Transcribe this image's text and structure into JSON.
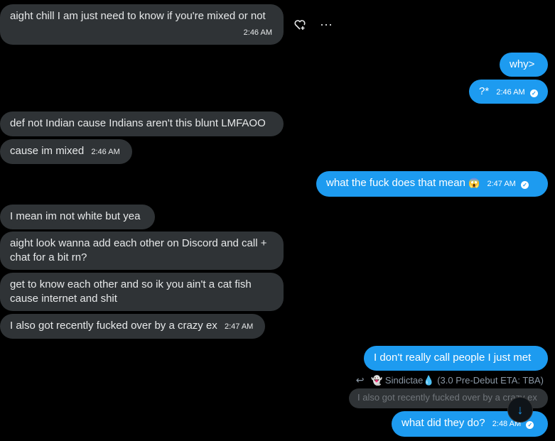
{
  "messages": {
    "m1": {
      "text": "aight chill I am just need to know if you're mixed or not",
      "time": "2:46 AM"
    },
    "m2": {
      "text": "why>"
    },
    "m3": {
      "text": "?*",
      "time": "2:46 AM"
    },
    "m4": {
      "text": "def not Indian cause Indians aren't this blunt LMFAOO"
    },
    "m5": {
      "text": "cause im mixed",
      "time": "2:46 AM"
    },
    "m6": {
      "text": "what the fuck does that mean",
      "emoji": "😱",
      "time": "2:47 AM"
    },
    "m7": {
      "text": "I mean im not white but yea"
    },
    "m8": {
      "text": "aight look wanna add each other on Discord and call + chat for a bit rn?"
    },
    "m9": {
      "text": "get to know each other and so ik you ain't a cat fish cause internet and shit"
    },
    "m10": {
      "text": "I also got recently fucked over by a crazy ex",
      "time": "2:47 AM"
    },
    "m11": {
      "text": "I don't really call people I just met"
    },
    "reply": {
      "name": "Sindictae",
      "emoji": "💧",
      "status": "(3.0 Pre-Debut ETA: TBA)",
      "quoted_text": "I also got recently fucked over by a crazy ex"
    },
    "m12": {
      "text": "what did they do?",
      "time": "2:48 AM"
    }
  },
  "icons": {
    "react": "heart-plus-icon",
    "more": "more-dots-icon",
    "reply": "reply-arrow-icon",
    "ghost": "ghost-emoji-icon",
    "scroll": "arrow-down-icon",
    "seen": "check-circle-icon"
  },
  "colors": {
    "background": "#000000",
    "incoming_bubble": "#2f3336",
    "outgoing_bubble": "#1d9bf0",
    "text": "#e7e9ea"
  }
}
